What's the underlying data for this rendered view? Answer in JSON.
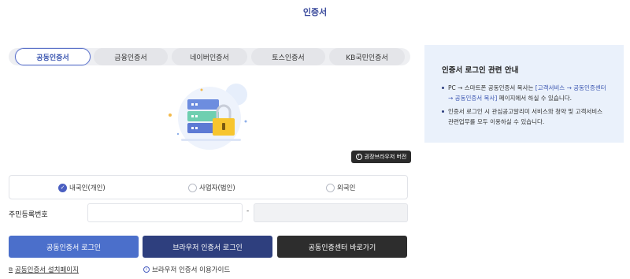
{
  "page": {
    "title": "인증서"
  },
  "tabs": [
    {
      "label": "공동인증서",
      "active": true
    },
    {
      "label": "금융인증서",
      "active": false
    },
    {
      "label": "네이버인증서",
      "active": false
    },
    {
      "label": "토스인증서",
      "active": false
    },
    {
      "label": "KB국민인증서",
      "active": false
    }
  ],
  "recommended_browser": {
    "label": "권장브라우저 버전",
    "icon": "info-icon"
  },
  "user_type": {
    "selected": "내국인(개인)",
    "options": [
      "내국인(개인)",
      "사업자(법인)",
      "외국인"
    ]
  },
  "rrn": {
    "label": "주민등록번호",
    "separator": "-",
    "front_value": "",
    "back_value": ""
  },
  "buttons": {
    "joint_login": "공동인증서 로그인",
    "browser_login": "브라우저 인증서 로그인",
    "center_shortcut": "공동인증센터 바로가기"
  },
  "links": {
    "install_page": "공동인증서 설치페이지",
    "browser_guide": "브라우저 인증서 이용가이드"
  },
  "guide": {
    "title": "인증서 로그인 관련 안내",
    "item1_prefix": "PC → 스마트폰 공동인증서 복사는 ",
    "item1_highlight": "[고객서비스 → 공동인증센터 → 공동인증서 복사]",
    "item1_suffix": " 페이지에서 하실 수 있습니다.",
    "item2": "인증서 로그인 시 관심공고알리미 서비스와 청약 및 고객서비스 관련업무를 모두 이용하실 수 있습니다."
  },
  "colors": {
    "accent": "#4a5fc1",
    "primary_button": "#4b6fcb",
    "navy_button": "#2e3f7e",
    "dark_button": "#2d2d2d",
    "guide_bg": "#eaf1fb"
  }
}
